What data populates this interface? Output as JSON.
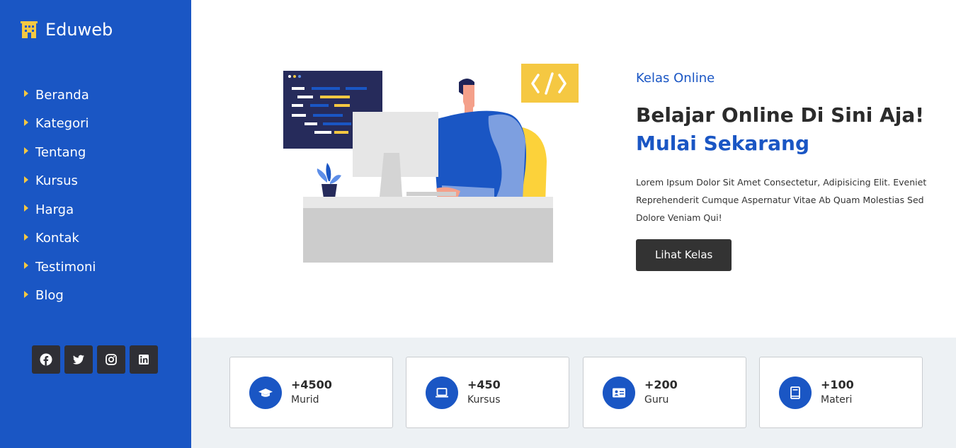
{
  "brand": {
    "name": "Eduweb",
    "icon": "building-icon"
  },
  "nav": {
    "items": [
      {
        "label": "Beranda"
      },
      {
        "label": "Kategori"
      },
      {
        "label": "Tentang"
      },
      {
        "label": "Kursus"
      },
      {
        "label": "Harga"
      },
      {
        "label": "Kontak"
      },
      {
        "label": "Testimoni"
      },
      {
        "label": "Blog"
      }
    ]
  },
  "socials": [
    "facebook-icon",
    "twitter-icon",
    "instagram-icon",
    "linkedin-icon"
  ],
  "hero": {
    "kicker": "Kelas Online",
    "headline": "Belajar Online Di Sini Aja!",
    "headline_accent": "Mulai Sekarang",
    "description": "Lorem Ipsum Dolor Sit Amet Consectetur, Adipisicing Elit. Eveniet Reprehenderit Cumque Aspernatur Vitae Ab Quam Molestias Sed Dolore Veniam Qui!",
    "cta_label": "Lihat Kelas"
  },
  "stats": [
    {
      "value": "+4500",
      "label": "Murid",
      "icon": "graduation-cap-icon"
    },
    {
      "value": "+450",
      "label": "Kursus",
      "icon": "laptop-icon"
    },
    {
      "value": "+200",
      "label": "Guru",
      "icon": "id-card-icon"
    },
    {
      "value": "+100",
      "label": "Materi",
      "icon": "book-icon"
    }
  ],
  "colors": {
    "primary": "#1a56c4",
    "accent": "#f5c842",
    "dark": "#333333",
    "band": "#edf1f4"
  }
}
